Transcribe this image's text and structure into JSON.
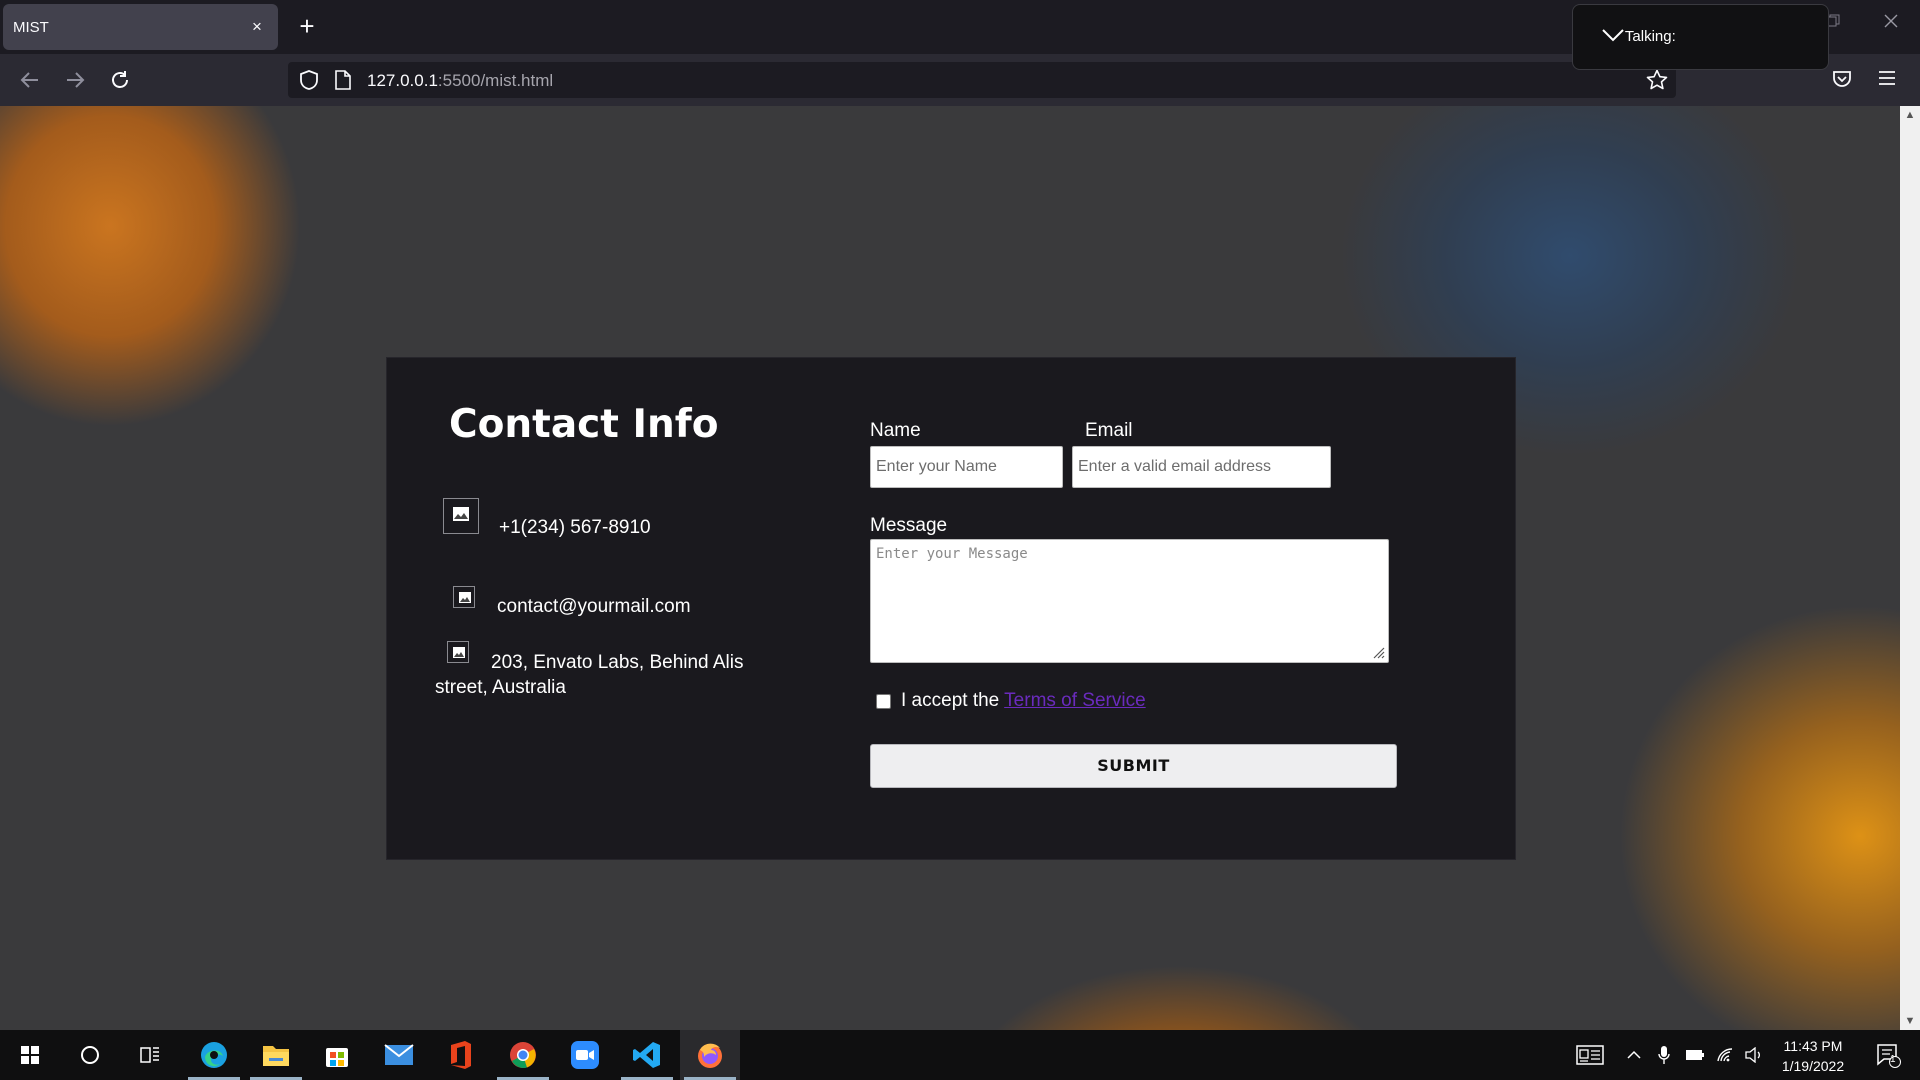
{
  "browser": {
    "tab_title": "MIST",
    "tab_close": "×",
    "new_tab": "+",
    "url_host": "127.0.0.1",
    "url_rest": ":5500/mist.html",
    "talking_label": "Talking:"
  },
  "contact": {
    "title": "Contact Info",
    "phone": "+1(234) 567-8910",
    "email": "contact@yourmail.com",
    "address_line1": "203, Envato Labs, Behind Alis",
    "address_line2": "street, Australia"
  },
  "form": {
    "name_label": "Name",
    "name_placeholder": "Enter your Name",
    "email_label": "Email",
    "email_placeholder": "Enter a valid email address",
    "message_label": "Message",
    "message_placeholder": "Enter your Message",
    "terms_prefix": "I accept the ",
    "terms_link": "Terms of Service",
    "submit_label": "SUBMIT"
  },
  "taskbar": {
    "time": "11:43 PM",
    "date": "1/19/2022",
    "notification_count": "1"
  },
  "colors": {
    "page_bg": "#3a3a3c",
    "card_bg": "#1a191e",
    "link": "#6a2bbd",
    "chrome_bg": "#2b2a33"
  }
}
